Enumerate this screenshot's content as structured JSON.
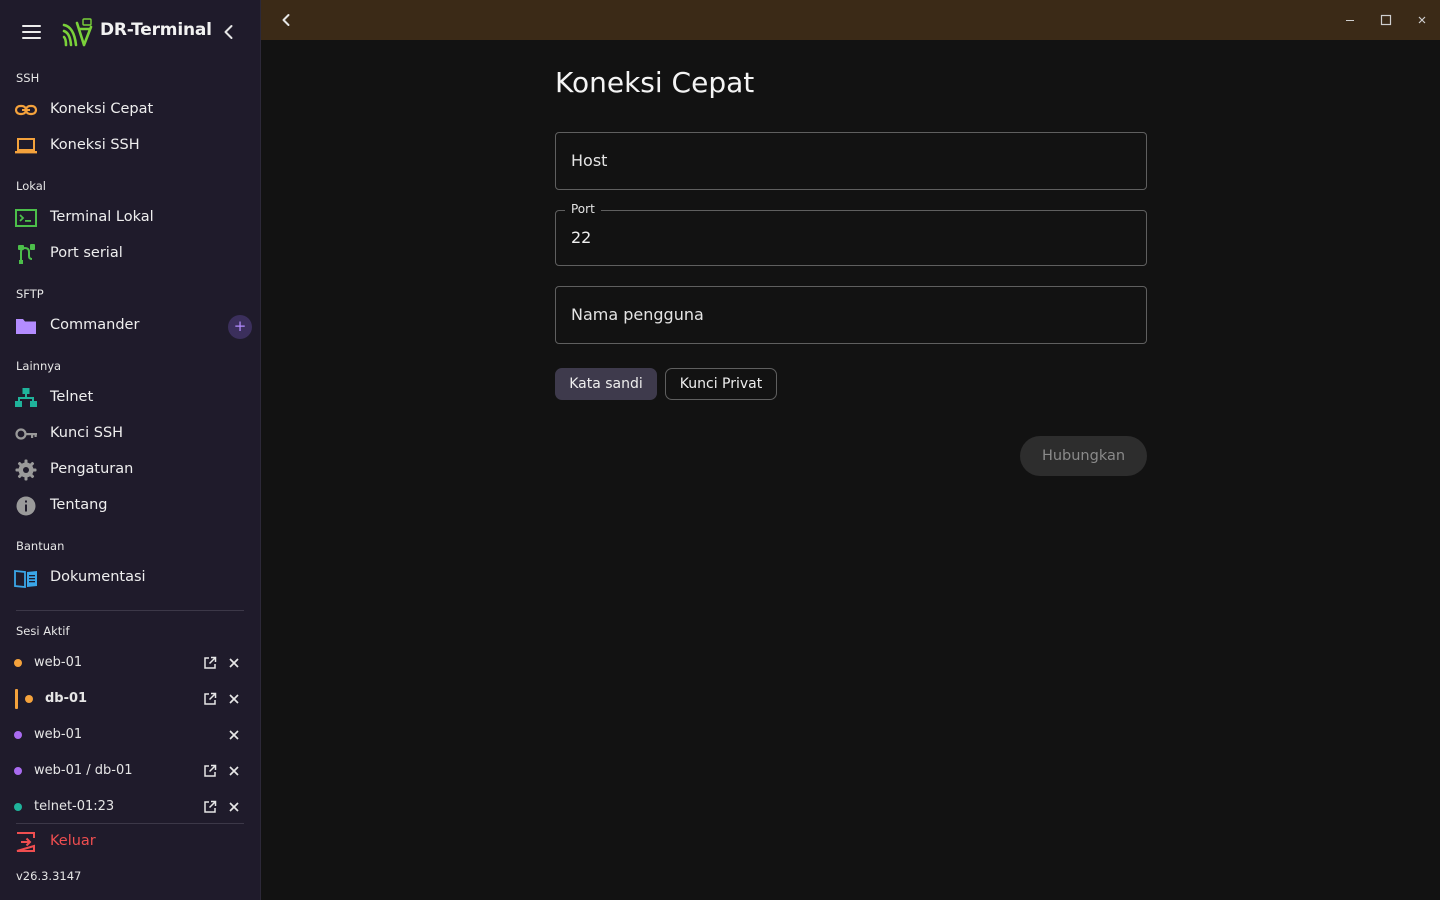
{
  "app": {
    "title": "DR-Terminal"
  },
  "sidebar": {
    "sections": {
      "ssh": "SSH",
      "local": "Lokal",
      "sftp": "SFTP",
      "other": "Lainnya",
      "help": "Bantuan",
      "active_sessions": "Sesi Aktif"
    },
    "items": {
      "quick_connect": {
        "label": "Koneksi Cepat",
        "icon": "link-icon"
      },
      "ssh_connection": {
        "label": "Koneksi SSH",
        "icon": "laptop-icon"
      },
      "local_terminal": {
        "label": "Terminal Lokal",
        "icon": "terminal-icon"
      },
      "serial_port": {
        "label": "Port serial",
        "icon": "cable-icon"
      },
      "commander": {
        "label": "Commander",
        "icon": "folder-icon",
        "action": "+"
      },
      "telnet": {
        "label": "Telnet",
        "icon": "network-icon"
      },
      "ssh_keys": {
        "label": "Kunci SSH",
        "icon": "key-icon"
      },
      "settings": {
        "label": "Pengaturan",
        "icon": "gear-icon"
      },
      "about": {
        "label": "Tentang",
        "icon": "info-icon"
      },
      "docs": {
        "label": "Dokumentasi",
        "icon": "book-icon"
      }
    },
    "sessions": [
      {
        "label": "web-01",
        "color": "#f4a23c",
        "active": false
      },
      {
        "label": "db-01",
        "color": "#f4a23c",
        "active": true
      },
      {
        "label": "web-01",
        "color": "#a96bf0",
        "active": false
      },
      {
        "label": "web-01 / db-01",
        "color": "#a96bf0",
        "active": false
      },
      {
        "label": "telnet-01:23",
        "color": "#1fb39b",
        "active": false
      }
    ],
    "logout": "Keluar",
    "version": "v26.3.3147"
  },
  "form": {
    "title": "Koneksi Cepat",
    "host": {
      "placeholder": "Host",
      "value": ""
    },
    "port": {
      "label": "Port",
      "value": "22"
    },
    "username": {
      "placeholder": "Nama pengguna",
      "value": ""
    },
    "auth_password": "Kata sandi",
    "auth_private_key": "Kunci Privat",
    "connect": "Hubungkan"
  },
  "colors": {
    "sidebar_bg": "#1f1b2b",
    "topbar_bg": "#3b2a17",
    "main_bg": "#121212",
    "accent": "#b38cff",
    "danger": "#ef4e50"
  }
}
